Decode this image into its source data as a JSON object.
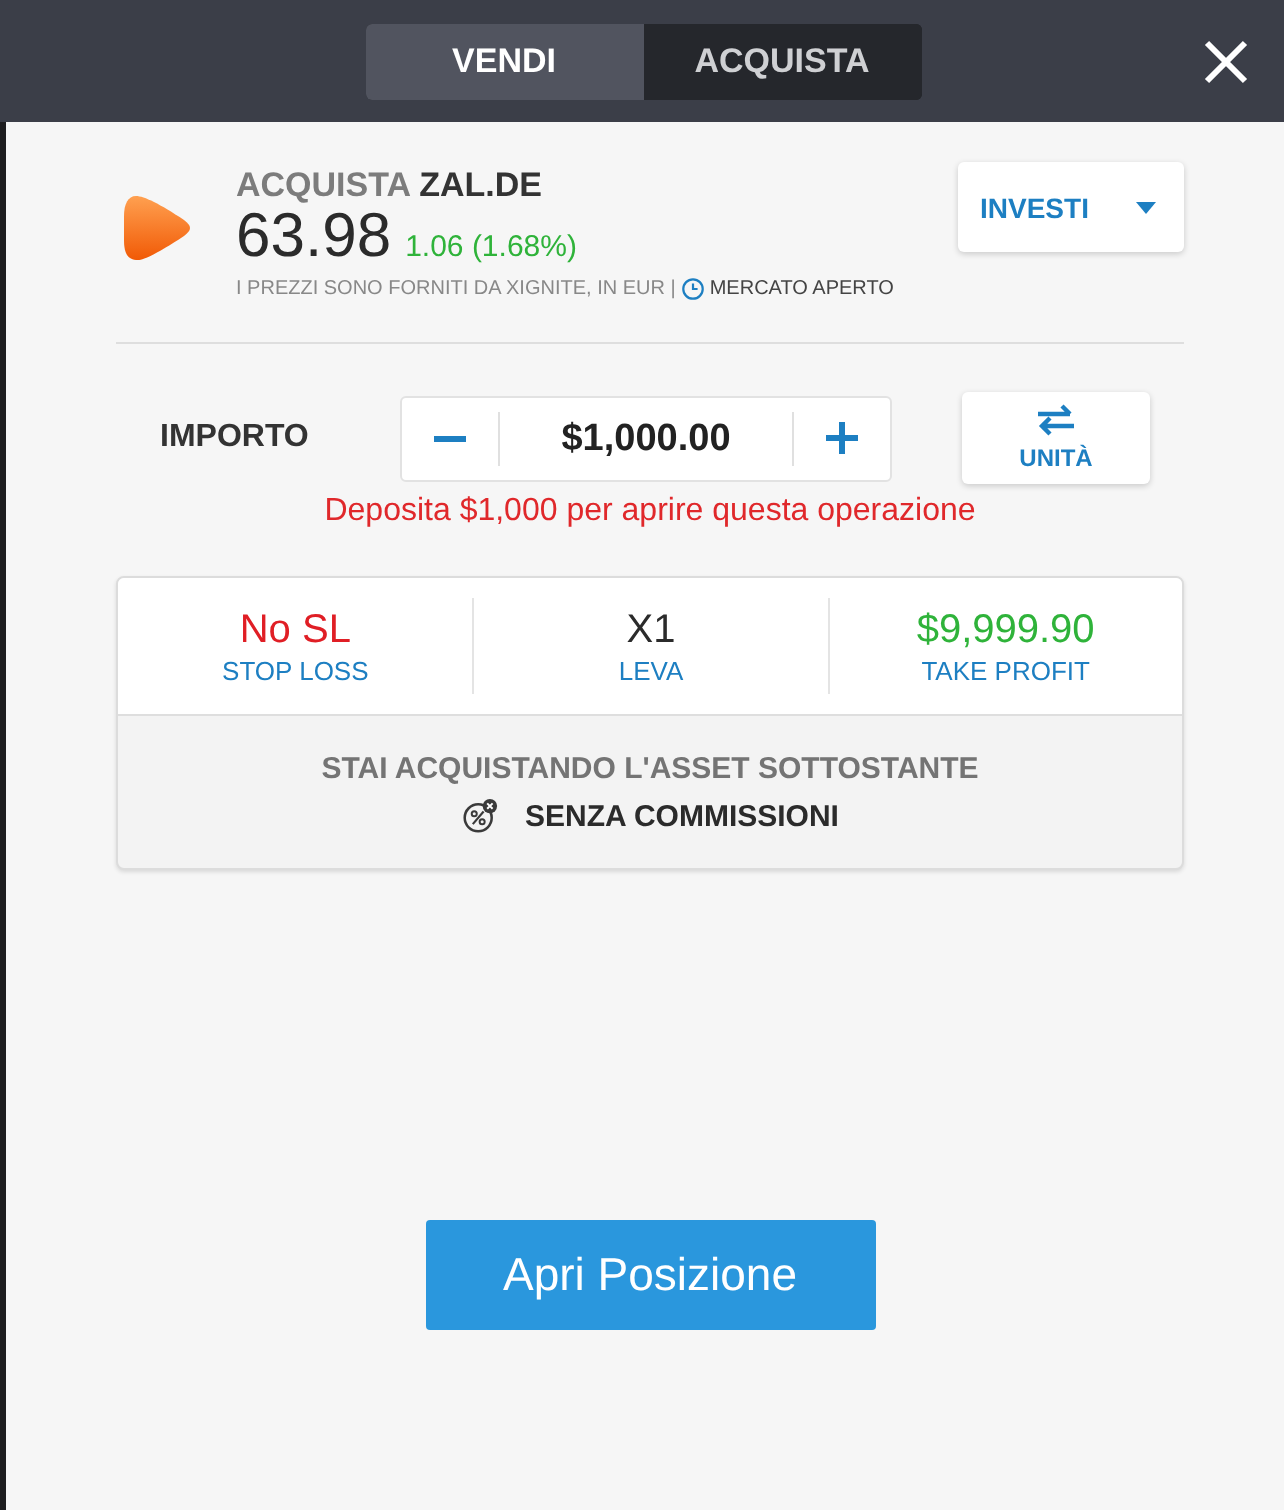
{
  "tabs": [
    {
      "label": "VENDI",
      "selected": false
    },
    {
      "label": "ACQUISTA",
      "selected": true
    }
  ],
  "instrument": {
    "action": "ACQUISTA",
    "symbol": "ZAL.DE",
    "price": "63.98",
    "change": "1.06 (1.68%)",
    "source_note": "I PREZZI SONO FORNITI DA XIGNITE, IN EUR |",
    "market_status": "MERCATO APERTO"
  },
  "mode_dropdown": {
    "label": "INVESTI"
  },
  "amount": {
    "label": "IMPORTO",
    "value": "$1,000.00",
    "warning": "Deposita $1,000 per aprire questa operazione"
  },
  "units_button": {
    "label": "UNITÀ"
  },
  "settings": [
    {
      "value": "No SL",
      "label": "STOP LOSS",
      "kind": "loss"
    },
    {
      "value": "X1",
      "label": "LEVA",
      "kind": "neutral"
    },
    {
      "value": "$9,999.90",
      "label": "TAKE PROFIT",
      "kind": "profit"
    }
  ],
  "info": {
    "headline": "STAI ACQUISTANDO L'ASSET SOTTOSTANTE",
    "commission": "SENZA COMMISSIONI"
  },
  "submit_button": {
    "label": "Apri Posizione"
  }
}
